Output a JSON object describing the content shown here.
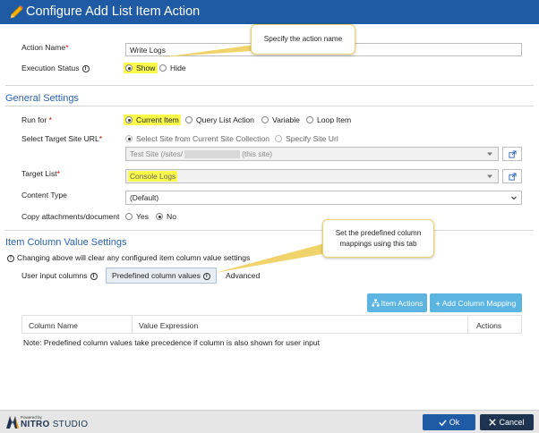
{
  "header": {
    "title": "Configure Add List Item Action"
  },
  "action_name": {
    "label": "Action Name",
    "value": "Write Logs"
  },
  "execution_status": {
    "label": "Execution Status",
    "options": [
      "Show",
      "Hide"
    ]
  },
  "general": {
    "title": "General Settings",
    "run_for": {
      "label": "Run for",
      "options": [
        "Current Item",
        "Query List Action",
        "Variable",
        "Loop Item"
      ]
    },
    "target_site": {
      "label": "Select Target Site URL",
      "options": [
        "Select Site from Current Site Collection",
        "Specify Site Url"
      ],
      "value": "Test Site (/sites/",
      "value_suffix": "(this site)"
    },
    "target_list": {
      "label": "Target List",
      "value": "Console Logs"
    },
    "content_type": {
      "label": "Content Type",
      "value": "(Default)"
    },
    "copy_attachments": {
      "label": "Copy attachments/document",
      "options": [
        "Yes",
        "No"
      ]
    }
  },
  "item_column": {
    "title": "Item Column Value Settings",
    "warning": "Changing above will clear any configured item column value settings",
    "tabs": [
      "User input columns",
      "Predefined column values",
      "Advanced"
    ],
    "buttons": {
      "item_actions": "Item Actions",
      "add_mapping": "Add Column Mapping"
    },
    "columns": [
      "Column Name",
      "Value Expression",
      "Actions"
    ],
    "note": "Note: Predefined column values take precedence if column is also shown for user input"
  },
  "callouts": {
    "action_name": "Specify the action name",
    "column_mappings": "Set the predefined column mappings using this tab"
  },
  "footer": {
    "logo_powered": "Powered by",
    "logo_brand": "NITRO",
    "logo_suffix": "STUDIO",
    "ok": "Ok",
    "cancel": "Cancel"
  },
  "colors": {
    "header": "#1f5ba4",
    "section": "#2a62b2",
    "highlight": "#fafa4a",
    "accent_button": "#5bb5e0"
  }
}
